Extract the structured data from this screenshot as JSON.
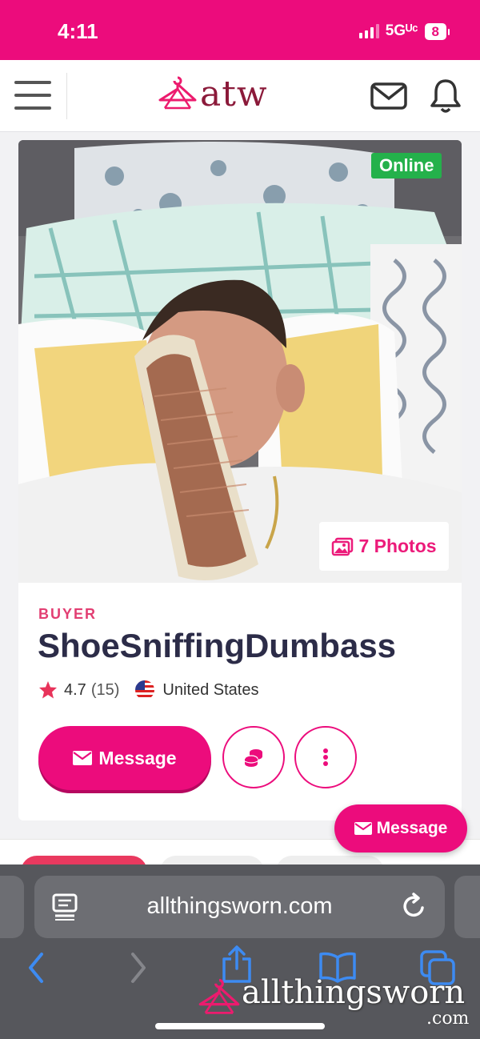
{
  "status_bar": {
    "time": "4:11",
    "network": "5Gᵁᶜ",
    "battery": "8"
  },
  "header": {
    "logo_text": "atw",
    "menu_icon": "hamburger-icon",
    "mail_icon": "envelope-icon",
    "bell_icon": "bell-icon"
  },
  "profile": {
    "online_label": "Online",
    "photos_label": "7 Photos",
    "role": "BUYER",
    "username": "ShoeSniffingDumbass",
    "rating": "4.7",
    "rating_count": "(15)",
    "country": "United States",
    "message_label": "Message"
  },
  "floating_message_label": "Message",
  "browser": {
    "url": "allthingsworn.com"
  },
  "watermark": {
    "main": "allthingsworn",
    "suffix": ".com"
  },
  "colors": {
    "brand": "#ec0c7c",
    "online": "#24b14b",
    "logo": "#8b1a3a",
    "safari_link": "#3d8bf2"
  }
}
